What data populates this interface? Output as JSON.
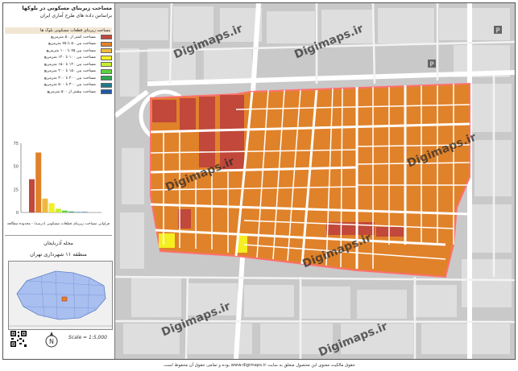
{
  "title": {
    "line1": "مساحت زیربنای مسکونی در بلوکها",
    "line2": "براساس داده های طرح آماری ایران"
  },
  "legend": {
    "header": "مساحت زیربنای قطعات مسکونی بلوک ها",
    "items": [
      {
        "label": "مساحت کمتر از ۵۰ مترمربع",
        "color": "#c1483a"
      },
      {
        "label": "مساحت بین ۵۰ تا ۷۵ مترمربع",
        "color": "#e0822a"
      },
      {
        "label": "مساحت بین ۷۵ تا ۱۰۰ مترمربع",
        "color": "#f0b840"
      },
      {
        "label": "مساحت بین ۱۰۰ تا ۱۲۰ مترمربع",
        "color": "#f5ee20"
      },
      {
        "label": "مساحت بین ۱۲۰ تا ۱۵۰ مترمربع",
        "color": "#c8ef30"
      },
      {
        "label": "مساحت بین ۱۵۰ تا ۲۰۰ مترمربع",
        "color": "#5cd43c"
      },
      {
        "label": "مساحت بین ۲۰۰ تا ۳۰۰ مترمربع",
        "color": "#2ca850"
      },
      {
        "label": "مساحت بین ۳۰۰ تا ۵۰۰ مترمربع",
        "color": "#1e7a8c"
      },
      {
        "label": "مساحت بیشتر از ۵۰۰ مترمربع",
        "color": "#1f5aa8"
      }
    ]
  },
  "chart_data": {
    "type": "bar",
    "categories": [
      "<50",
      "50-75",
      "75-100",
      "100-120",
      "120-150",
      "150-200",
      "200-300",
      "300-500",
      ">500"
    ],
    "values": [
      36,
      65,
      15,
      10,
      4,
      2,
      1,
      0.5,
      0.5
    ],
    "colors": [
      "#c1483a",
      "#e0822a",
      "#f0b840",
      "#f5ee20",
      "#c8ef30",
      "#5cd43c",
      "#2ca850",
      "#1e7a8c",
      "#1f5aa8"
    ],
    "yticks": [
      "0",
      "25",
      "50",
      "75"
    ],
    "ylim": [
      0,
      75
    ],
    "caption": "فراوانی مساحت زیربنای قطعات مسکونی (درصد) - محدوده مطالعه"
  },
  "region": {
    "name": "محله آذربایجان",
    "district": "منطقه ۱۱ شهرداری تهران"
  },
  "scale": {
    "text": "Scale = 1:5,000"
  },
  "north": {
    "label": "N"
  },
  "watermarks": [
    "Digimaps.ir"
  ],
  "map_labels": {
    "poi_1": "P",
    "poi_2": "P"
  },
  "footer": {
    "text": "حقوق مالکیت معنوی این محصول متعلق به سایت www.digimaps.ir بوده و تمامی حقوق آن محفوظ است."
  }
}
